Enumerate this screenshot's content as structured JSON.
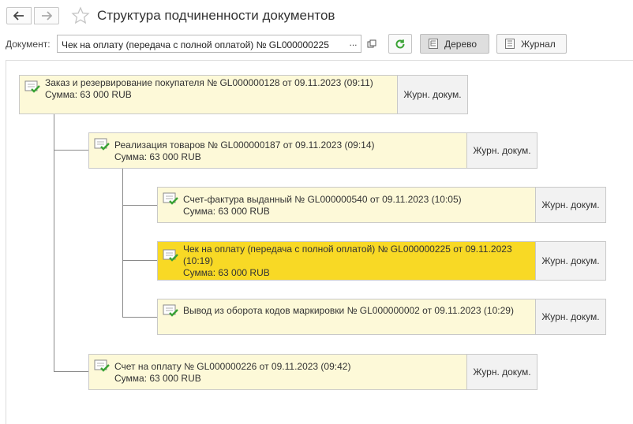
{
  "header": {
    "title": "Структура подчиненности документов"
  },
  "toolbar": {
    "document_label": "Документ:",
    "document_value": "Чек на оплату (передача с полной оплатой) № GL000000225",
    "dots": "...",
    "tree_label": "Дерево",
    "journal_label": "Журнал"
  },
  "nodes": [
    {
      "title": "Заказ и резервирование покупателя № GL000000128 от 09.11.2023 (09:11)",
      "amount": "Сумма: 63 000 RUB",
      "journal": "Журн. докум.",
      "active": false
    },
    {
      "title": "Реализация товаров № GL000000187 от 09.11.2023 (09:14)",
      "amount": "Сумма: 63 000 RUB",
      "journal": "Журн. докум.",
      "active": false
    },
    {
      "title": "Счет-фактура выданный № GL000000540 от 09.11.2023 (10:05)",
      "amount": "Сумма: 63 000 RUB",
      "journal": "Журн. докум.",
      "active": false
    },
    {
      "title": "Чек на оплату (передача с полной оплатой) № GL000000225 от 09.11.2023 (10:19)",
      "amount": "Сумма: 63 000 RUB",
      "journal": "Журн. докум.",
      "active": true
    },
    {
      "title": "Вывод из оборота кодов маркировки № GL000000002 от 09.11.2023 (10:29)",
      "amount": "",
      "journal": "Журн. докум.",
      "active": false
    },
    {
      "title": "Счет на оплату № GL000000226 от 09.11.2023 (09:42)",
      "amount": "Сумма: 63 000 RUB",
      "journal": "Журн. докум.",
      "active": false
    }
  ],
  "colors": {
    "node_bg": "#fdf9d8",
    "node_active_bg": "#f8d925",
    "check_green": "#3aa335"
  },
  "icons": {
    "back": "arrow-left-icon",
    "forward": "arrow-right-icon",
    "favorite": "star-icon",
    "open": "open-in-window-icon",
    "refresh": "refresh-icon",
    "tree": "tree-view-icon",
    "journal": "journal-list-icon",
    "document": "document-posted-icon"
  }
}
